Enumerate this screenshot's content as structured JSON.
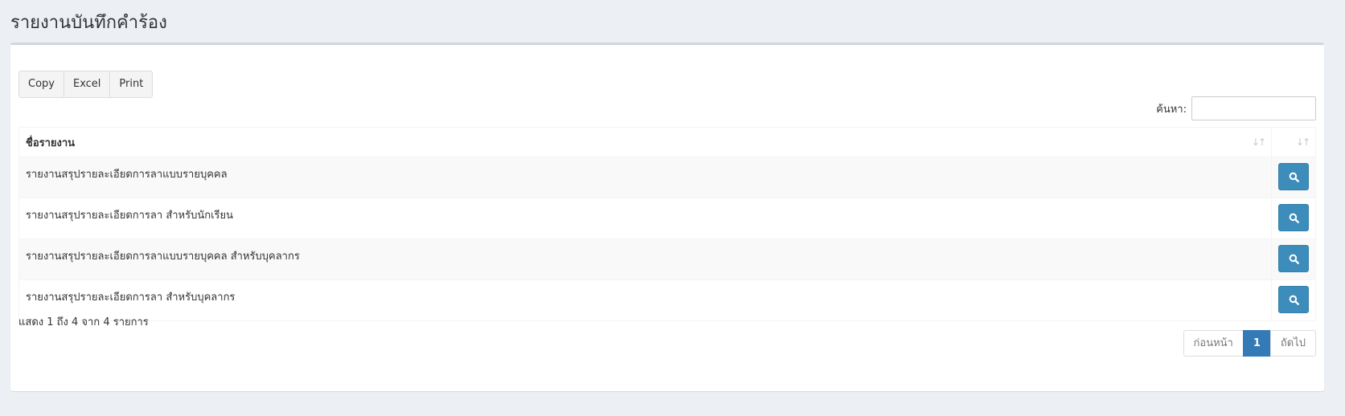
{
  "page": {
    "title": "รายงานบันทึกคำร้อง"
  },
  "toolbar": {
    "copy_label": "Copy",
    "excel_label": "Excel",
    "print_label": "Print"
  },
  "search": {
    "label": "ค้นหา:",
    "value": ""
  },
  "table": {
    "columns": [
      "ชื่อรายงาน",
      ""
    ],
    "sort_icon": "sort-both-icon",
    "view_icon": "search-icon",
    "rows": [
      {
        "name": "รายงานสรุปรายละเอียดการลาแบบรายบุคคล"
      },
      {
        "name": "รายงานสรุปรายละเอียดการลา สำหรับนักเรียน"
      },
      {
        "name": "รายงานสรุปรายละเอียดการลาแบบรายบุคคล สำหรับบุคลากร"
      },
      {
        "name": "รายงานสรุปรายละเอียดการลา สำหรับบุคลากร"
      }
    ]
  },
  "info": {
    "text": "แสดง 1 ถึง 4 จาก 4 รายการ"
  },
  "pagination": {
    "prev_label": "ก่อนหน้า",
    "current_page": "1",
    "next_label": "ถัดไป"
  },
  "colors": {
    "primary": "#3c8dbc",
    "page_active": "#337ab7",
    "background": "#ecf0f5"
  }
}
